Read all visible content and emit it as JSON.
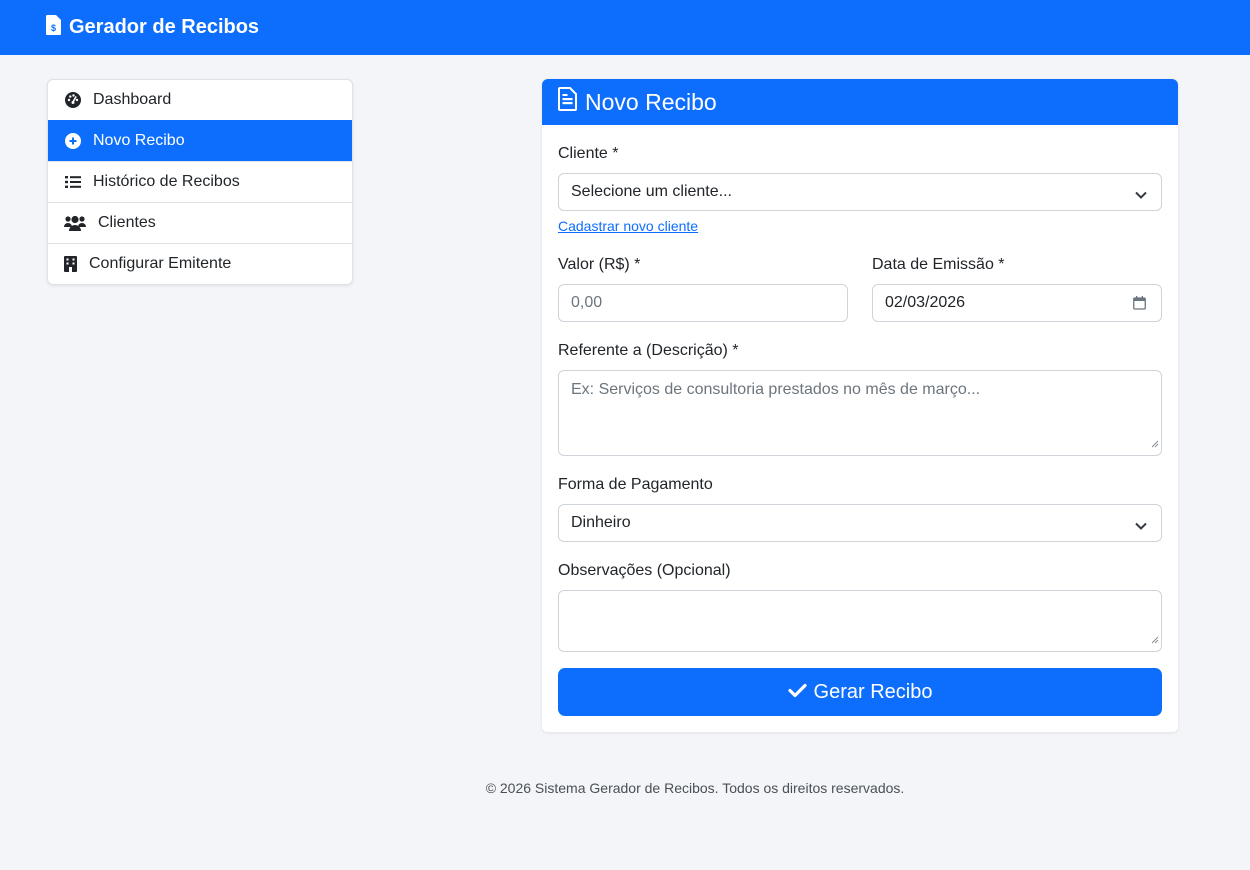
{
  "app": {
    "brand": "Gerador de Recibos"
  },
  "sidebar": {
    "items": [
      {
        "label": "Dashboard",
        "icon": "gauge-icon"
      },
      {
        "label": "Novo Recibo",
        "icon": "plus-circle-icon",
        "active": true
      },
      {
        "label": "Histórico de Recibos",
        "icon": "list-icon"
      },
      {
        "label": "Clientes",
        "icon": "users-icon"
      },
      {
        "label": "Configurar Emitente",
        "icon": "building-icon"
      }
    ]
  },
  "form": {
    "title": "Novo Recibo",
    "cliente_label": "Cliente *",
    "cliente_value": "Selecione um cliente...",
    "new_client_link": "Cadastrar novo cliente",
    "valor_label": "Valor (R$) *",
    "valor_placeholder": "0,00",
    "data_label": "Data de Emissão *",
    "data_value": "02/03/2026",
    "referente_label": "Referente a (Descrição) *",
    "referente_placeholder": "Ex: Serviços de consultoria prestados no mês de março...",
    "pagamento_label": "Forma de Pagamento",
    "pagamento_value": "Dinheiro",
    "obs_label": "Observações (Opcional)",
    "submit_label": "Gerar Recibo"
  },
  "footer": {
    "text": "© 2026 Sistema Gerador de Recibos. Todos os direitos reservados."
  },
  "colors": {
    "primary": "#0d6efd",
    "background": "#f4f5f8"
  }
}
